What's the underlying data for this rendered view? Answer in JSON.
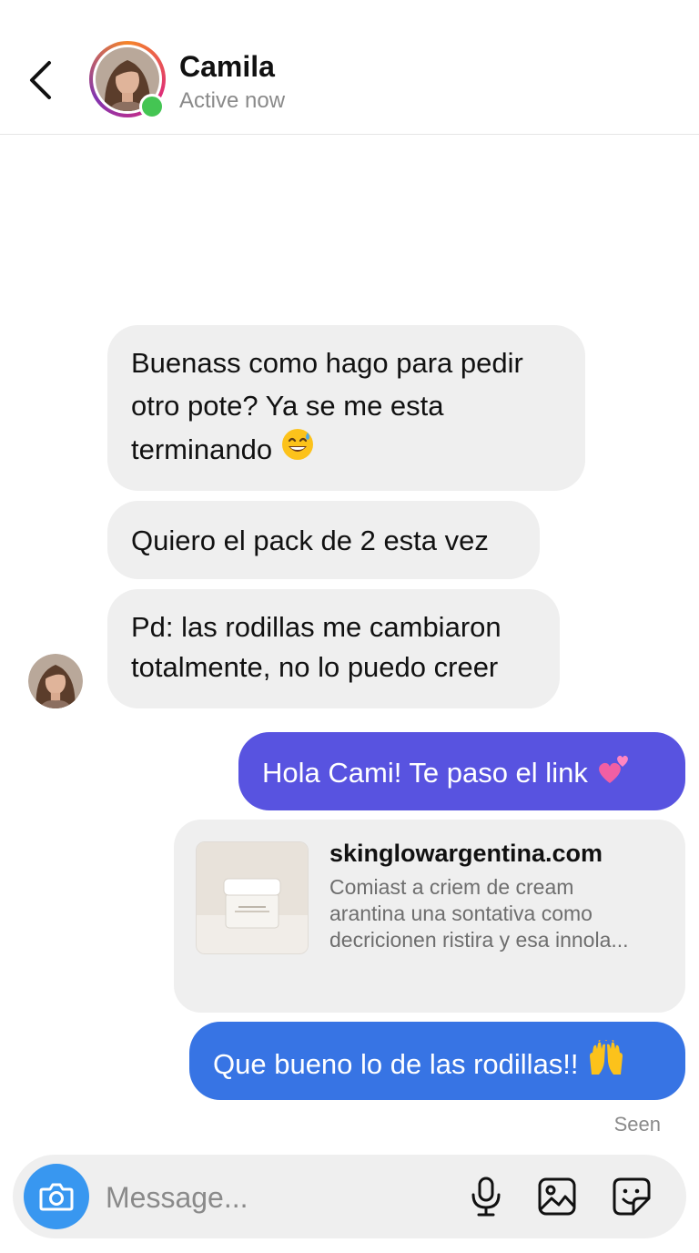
{
  "header": {
    "name": "Camila",
    "status": "Active now"
  },
  "messages": {
    "incoming": [
      {
        "lines": [
          "Buenass como hago para pedir",
          "otro pote? Ya se me esta",
          "terminando"
        ],
        "emoji": "sweat-smile"
      },
      {
        "lines": [
          "Quiero el pack de 2 esta vez"
        ]
      },
      {
        "lines": [
          "Pd: las rodillas me cambiaron",
          "totalmente, no lo puedo creer"
        ]
      }
    ],
    "outgoing_1": {
      "text": "Hola Cami! Te paso el link",
      "emoji": "two-hearts",
      "color": "#5853e0"
    },
    "link_card": {
      "domain": "skinglowargentina.com",
      "desc_lines": [
        "Comiast a criem de cream",
        "arantina una sontativa como",
        "decricionen ristira y esa innola..."
      ]
    },
    "outgoing_2": {
      "text": "Que bueno lo de las rodillas!!",
      "emoji": "raising-hands",
      "color": "#3774e4"
    },
    "seen": "Seen"
  },
  "composer": {
    "placeholder": "Message...",
    "icons": [
      "camera-icon",
      "microphone-icon",
      "gallery-icon",
      "sticker-icon"
    ]
  },
  "colors": {
    "incoming_bubble": "#efefef",
    "accent_blue": "#3897f0",
    "online": "#44c553"
  }
}
